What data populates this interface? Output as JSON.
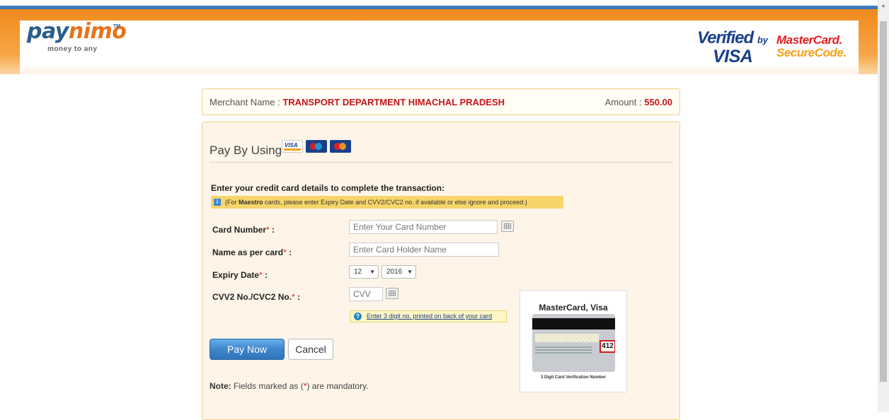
{
  "header": {
    "logo": {
      "pay": "pay",
      "nimo": "nimo",
      "tm": "TM",
      "tagline": "money to any"
    },
    "verified_by_visa": {
      "line1": "Verified",
      "by": "by",
      "line2": "VISA"
    },
    "mastercard_securecode": {
      "line1": "MasterCard.",
      "line2": "SecureCode."
    }
  },
  "merchant": {
    "name_label": "Merchant Name : ",
    "name_value": "TRANSPORT DEPARTMENT HIMACHAL PRADESH",
    "amount_label": "Amount : ",
    "amount_value": "550.00"
  },
  "form": {
    "pay_by_label": "Pay By Using",
    "card_logos": [
      "VISA",
      "Maestro",
      "MasterCard"
    ],
    "instruction": "Enter your credit card details to complete the transaction:",
    "maestro_note_prefix": "(For ",
    "maestro_note_bold": "Maestro",
    "maestro_note_suffix": " cards, please enter Expiry Date and CVV2/CVC2 no. if available or else ignore and proceed.)",
    "card_number": {
      "label": "Card Number",
      "req": "*",
      "colon": " :",
      "placeholder": "Enter Your Card Number"
    },
    "name_on_card": {
      "label": "Name as per card",
      "req": "*",
      "colon": " :",
      "placeholder": "Enter Card Holder Name"
    },
    "expiry": {
      "label": "Expiry Date",
      "req": "*",
      "colon": " :",
      "month": "12",
      "year": "2016",
      "arrow": "▼"
    },
    "cvv": {
      "label": "CVV2 No./CVC2 No.",
      "req": "*",
      "colon": " :",
      "placeholder": "CVV"
    },
    "cvv_hint": "Enter 3 digit no. printed on back of your card",
    "help_glyph": "?",
    "info_glyph": "i",
    "pay_button": "Pay Now",
    "cancel_button": "Cancel",
    "note_bold": "Note:",
    "note_before": " Fields marked as (",
    "note_star": "*",
    "note_after": ") are mandatory."
  },
  "cvv_card": {
    "title": "MasterCard, Visa",
    "cvv_number": "412",
    "caption": "3 Digit Card Verification Number"
  },
  "scrollbar": {
    "up_arrow": "▲"
  },
  "colors": {
    "accent_orange": "#f08a1c",
    "brand_blue": "#2a5d8f",
    "required_red": "#e02020",
    "merchant_red": "#c4141a"
  }
}
